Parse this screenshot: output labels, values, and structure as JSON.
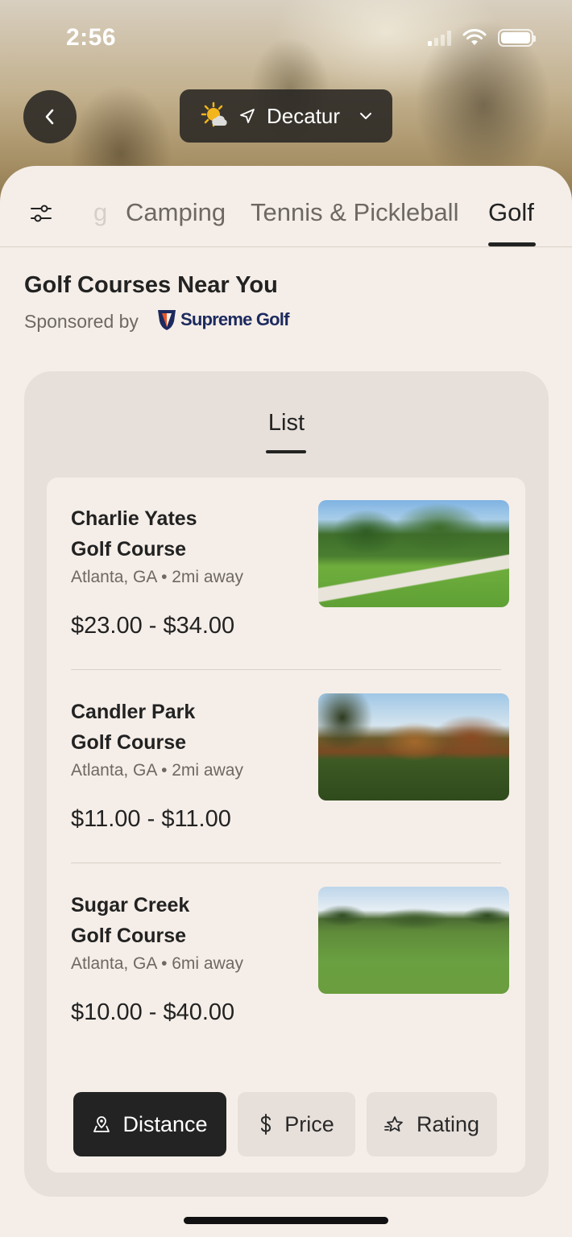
{
  "status_bar": {
    "time": "2:56"
  },
  "header": {
    "location": "Decatur",
    "icons": {
      "back": "chevron-left-icon",
      "weather": "partly-sunny-icon",
      "navigation": "navigation-arrow-icon",
      "dropdown": "chevron-down-icon"
    }
  },
  "tabs": {
    "items": [
      {
        "label": "g",
        "active": false
      },
      {
        "label": "Camping",
        "active": false
      },
      {
        "label": "Tennis & Pickleball",
        "active": false
      },
      {
        "label": "Golf",
        "active": true
      }
    ]
  },
  "section": {
    "title": "Golf Courses Near You",
    "sponsored_by": "Sponsored by",
    "sponsor_name": "Supreme Golf"
  },
  "card": {
    "view_tab": "List",
    "courses": [
      {
        "name_line1": "Charlie Yates",
        "name_line2": "Golf Course",
        "meta": "Atlanta, GA • 2mi away",
        "price": "$23.00 - $34.00"
      },
      {
        "name_line1": "Candler Park",
        "name_line2": "Golf Course",
        "meta": "Atlanta, GA • 2mi away",
        "price": "$11.00 - $11.00"
      },
      {
        "name_line1": "Sugar Creek",
        "name_line2": "Golf Course",
        "meta": "Atlanta, GA • 6mi away",
        "price": "$10.00 - $40.00"
      }
    ],
    "sort": {
      "distance": "Distance",
      "price": "Price",
      "rating": "Rating",
      "selected": "Distance"
    }
  },
  "colors": {
    "background": "#f5eee8",
    "card": "#e7e0da",
    "dark": "#232323",
    "muted_text": "#6e6862",
    "sponsor_navy": "#1c2a5e",
    "sponsor_orange": "#e8552a"
  }
}
